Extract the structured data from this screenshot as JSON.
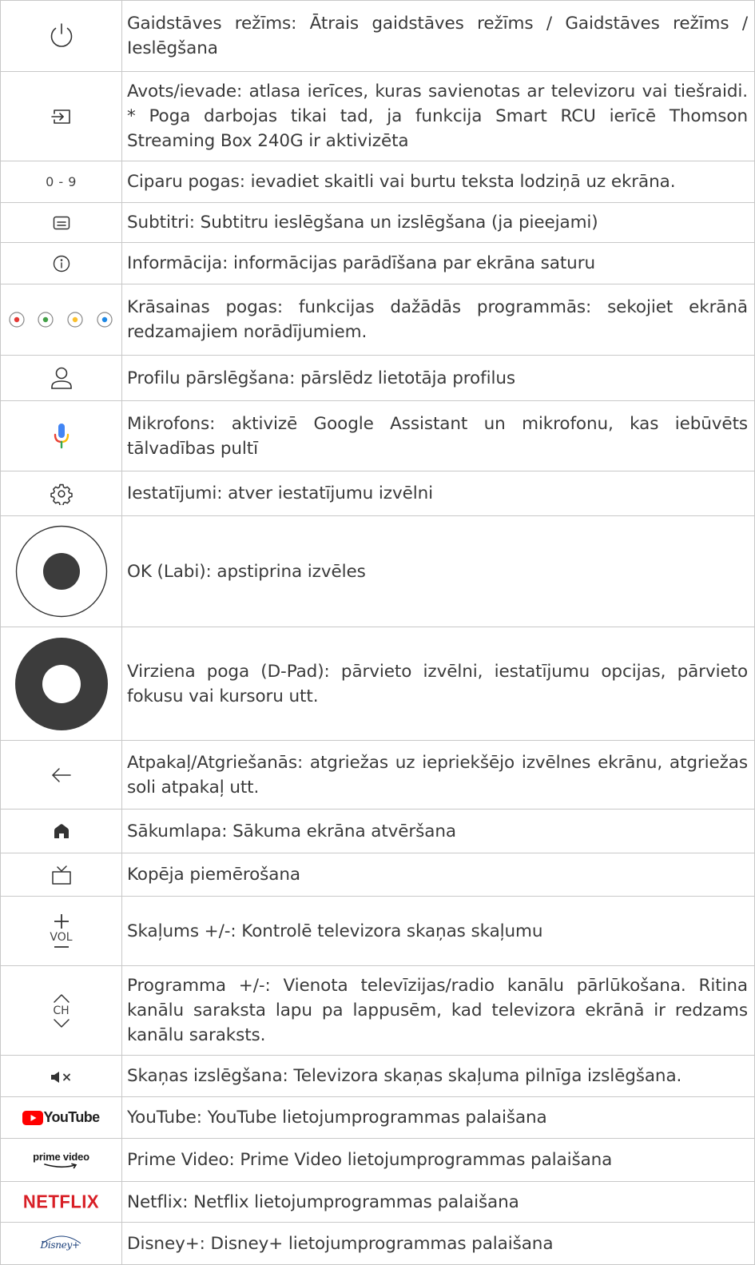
{
  "rows": [
    {
      "icon": "power-icon",
      "text": "Gaidstāves režīms: Ātrais gaidstāves režīms / Gaidstāves režīms / Ieslēgšana"
    },
    {
      "icon": "source-input-icon",
      "text": "Avots/ievade: atlasa ierīces, kuras savienotas ar televizoru vai tiešraidi. * Poga darbojas tikai tad, ja funkcija Smart RCU ierīcē Thomson Streaming Box 240G ir aktivizēta"
    },
    {
      "icon": "digits-label",
      "label": "0 - 9",
      "text": "Ciparu pogas: ievadiet skaitli vai burtu teksta lodziņā uz ekrāna."
    },
    {
      "icon": "subtitles-icon",
      "text": "Subtitri: Subtitru ieslēgšana un izslēgšana (ja pieejami)"
    },
    {
      "icon": "info-icon",
      "text": "Informācija: informācijas parādīšana par ekrāna saturu"
    },
    {
      "icon": "color-buttons-icon",
      "colors": [
        "#e53935",
        "#43a047",
        "#fbc02d",
        "#1e88e5"
      ],
      "text": "Krāsainas pogas: funkcijas dažādās programmās: sekojiet ekrānā redzamajiem norādījumiem."
    },
    {
      "icon": "profile-icon",
      "text": "Profilu pārslēgšana: pārslēdz lietotāja profilus"
    },
    {
      "icon": "microphone-icon",
      "text": "Mikrofons: aktivizē Google Assistant un mikrofonu, kas iebūvēts tālvadības pultī"
    },
    {
      "icon": "gear-icon",
      "text": "Iestatījumi: atver iestatījumu izvēlni"
    },
    {
      "icon": "ok-button-icon",
      "text": "OK (Labi): apstiprina izvēles"
    },
    {
      "icon": "dpad-icon",
      "text": "Virziena poga (D-Pad): pārvieto izvēlni, iestatījumu opcijas, pārvieto fokusu vai kursoru utt."
    },
    {
      "icon": "back-arrow-icon",
      "text": "Atpakaļ/Atgriešanās: atgriežas uz iepriekšējo izvēlnes ekrānu, atgriežas soli atpakaļ utt."
    },
    {
      "icon": "home-icon",
      "text": "Sākumlapa: Sākuma ekrāna atvēršana"
    },
    {
      "icon": "tv-icon",
      "text": "Kopēja piemērošana"
    },
    {
      "icon": "volume-icon",
      "label": "VOL",
      "text": "Skaļums +/-: Kontrolē televizora skaņas skaļumu"
    },
    {
      "icon": "channel-icon",
      "label": "CH",
      "text": "Programma +/-: Vienota televīzijas/radio kanālu pārlūkošana. Ritina kanālu saraksta lapu pa lappusēm, kad televizora ekrānā ir redzams kanālu saraksts."
    },
    {
      "icon": "mute-icon",
      "text": "Skaņas izslēgšana: Televizora skaņas skaļuma pilnīga izslēgšana."
    },
    {
      "icon": "youtube-logo",
      "label": "YouTube",
      "text": "YouTube: YouTube lietojumprogrammas palaišana"
    },
    {
      "icon": "prime-video-logo",
      "label": "prime video",
      "text": "Prime Video: Prime Video lietojumprogrammas palaišana"
    },
    {
      "icon": "netflix-logo",
      "label": "NETFLIX",
      "text": "Netflix: Netflix lietojumprogrammas palaišana"
    },
    {
      "icon": "disney-plus-logo",
      "label": "Disney+",
      "text": "Disney+: Disney+  lietojumprogrammas palaišana"
    }
  ]
}
